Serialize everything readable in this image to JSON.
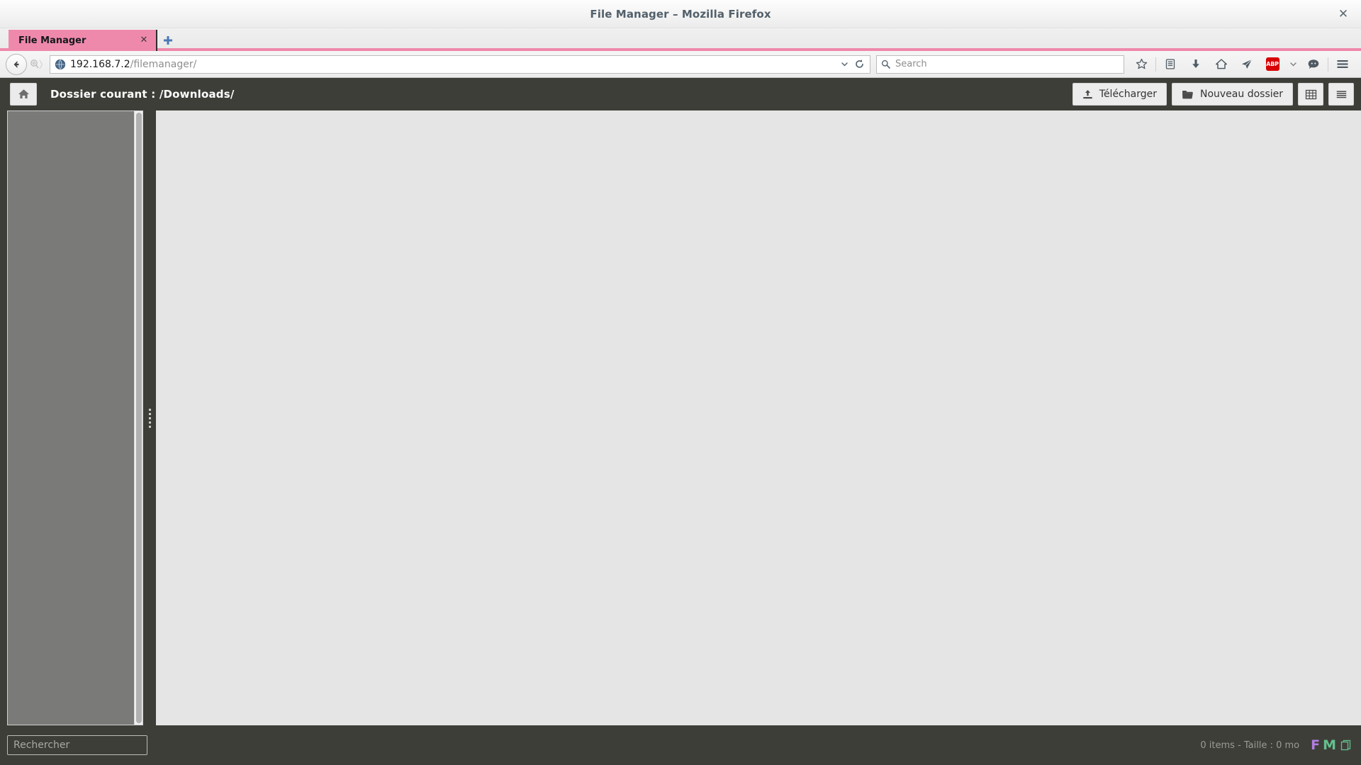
{
  "window": {
    "title": "File Manager – Mozilla Firefox",
    "close_label": "✕"
  },
  "tabs": {
    "items": [
      {
        "label": "File Manager",
        "close_label": "✕",
        "active": true
      }
    ],
    "new_tab_label": "+",
    "active_tab_color": "#ef89ac"
  },
  "navbar": {
    "back_icon": "back-arrow-icon",
    "forward_icon": "forward-arrow-icon",
    "favicon": "globe-icon",
    "url_host": "192.168.7.2",
    "url_path": "/filemanager/",
    "url_full": "192.168.7.2/filemanager/",
    "history_chevron_icon": "chevron-down-icon",
    "reload_icon": "reload-icon",
    "search_placeholder": "Search",
    "search_value": "",
    "icons": [
      {
        "name": "bookmark-star-icon",
        "label": "Bookmark"
      },
      {
        "name": "reading-list-icon",
        "label": "Reading list"
      },
      {
        "name": "downloads-icon",
        "label": "Downloads"
      },
      {
        "name": "home-icon",
        "label": "Home"
      },
      {
        "name": "send-tab-icon",
        "label": "Send tab"
      },
      {
        "name": "adblock-plus-icon",
        "label": "ABP"
      },
      {
        "name": "chevron-down-icon",
        "label": "More"
      },
      {
        "name": "chat-bubble-icon",
        "label": "Chat"
      },
      {
        "name": "hamburger-menu-icon",
        "label": "Menu"
      }
    ],
    "adblock_badge_text": "ABP",
    "adblock_badge_color": "#d80000"
  },
  "filemanager": {
    "home_button_icon": "home-icon",
    "path_label": "Dossier courant : /Downloads/",
    "actions": [
      {
        "name": "upload-button",
        "label": "Télécharger",
        "icon": "upload-icon"
      },
      {
        "name": "new-folder-button",
        "label": "Nouveau dossier",
        "icon": "folder-icon"
      }
    ],
    "view_buttons": [
      {
        "name": "grid-view-button",
        "icon": "grid-icon"
      },
      {
        "name": "list-view-button",
        "icon": "list-icon"
      }
    ],
    "sidebar": {
      "items": []
    },
    "content": {
      "items": []
    },
    "footer": {
      "search_placeholder": "Rechercher",
      "search_value": "",
      "stats": "0 items - Taille : 0 mo",
      "item_count": 0,
      "size_label": "0 mo",
      "logo_f": "F",
      "logo_m": "M",
      "logo_f_color": "#b07ee0",
      "logo_m_color": "#63c08e",
      "logo_doc_icon": "documents-icon"
    }
  }
}
